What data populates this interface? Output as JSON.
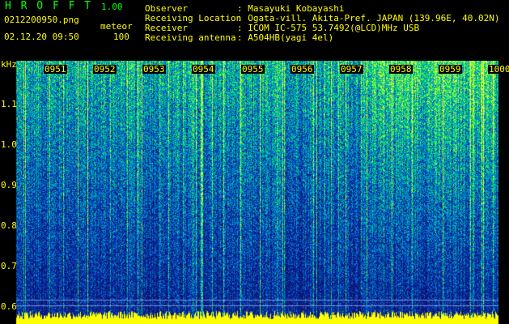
{
  "header": {
    "app_title": "H R O F F T",
    "version": "1.00",
    "filename": "0212200950.png",
    "mode": "meteor",
    "datetime": "02.12.20 09:50",
    "count": "100",
    "observer_label": "Observer",
    "observer_value": ": Masayuki Kobayashi",
    "location_label": "Receiving Location",
    "location_value": ": Ogata-vill. Akita-Pref. JAPAN (139.96E, 40.02N)",
    "receiver_label": "Receiver",
    "receiver_value": ": ICOM IC-575 53.7492(@LCD)MHz USB",
    "antenna_label": "Receiving antenna",
    "antenna_value": ": A504HB(yagi 4el)"
  },
  "colors": {
    "text_yellow": "#ffff00",
    "title_green": "#00ff00",
    "background": "#000000",
    "spectrum_low": "#0a1a80",
    "spectrum_high": "#00ff80"
  },
  "chart_data": {
    "type": "heatmap",
    "title": "",
    "ylabel": "kHz",
    "xlabel": "",
    "y_ticks": [
      "1.1",
      "1.0",
      "0.9",
      "0.8",
      "0.7",
      "0.6"
    ],
    "x_ticks": [
      "0951",
      "0952",
      "0953",
      "0954",
      "0955",
      "0956",
      "0957",
      "0958",
      "0959",
      "1000"
    ],
    "ylim": [
      0.58,
      1.17
    ]
  }
}
